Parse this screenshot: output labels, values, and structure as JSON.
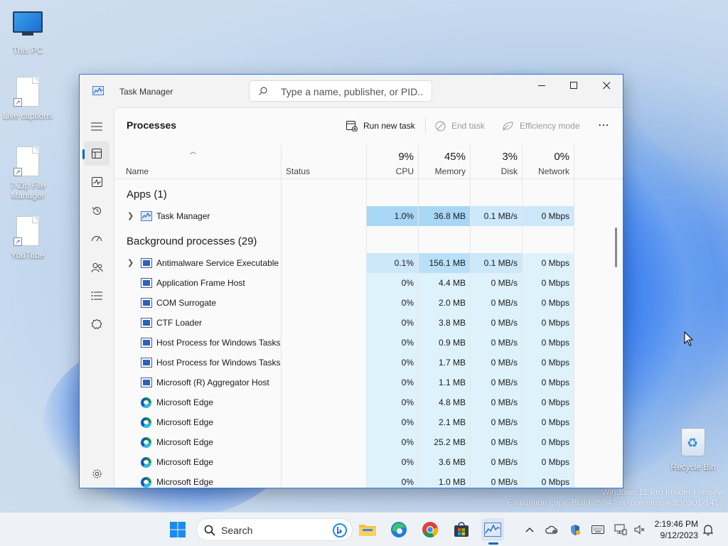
{
  "desktop": {
    "icons": [
      "This PC",
      "Live captions",
      "7-Zip File Manager",
      "YouTube",
      "Recycle Bin"
    ],
    "watermark_line1": "Windows 11 Pro Insider Preview",
    "watermark_line2": "Evaluation copy. Build 25947.rs_prerelease.230901-1416"
  },
  "window": {
    "title": "Task Manager",
    "search_placeholder": "Type a name, publisher, or PID...",
    "controls": [
      "minimize-icon",
      "maximize-icon",
      "close-icon"
    ]
  },
  "nav": {
    "items": [
      "hamburger-icon",
      "processes-icon",
      "performance-icon",
      "app-history-icon",
      "startup-apps-icon",
      "users-icon",
      "details-icon",
      "services-icon",
      "settings-icon"
    ],
    "active": "processes"
  },
  "page": {
    "title": "Processes",
    "run_new_task": "Run new task",
    "end_task": "End task",
    "efficiency_mode": "Efficiency mode",
    "more": "⋯"
  },
  "columns": {
    "name": "Name",
    "status": "Status",
    "cpu_pct": "9%",
    "cpu": "CPU",
    "memory_pct": "45%",
    "memory": "Memory",
    "disk_pct": "3%",
    "disk": "Disk",
    "network_pct": "0%",
    "network": "Network"
  },
  "groups": {
    "apps": "Apps (1)",
    "background": "Background processes (29)"
  },
  "apps": [
    {
      "name": "Task Manager",
      "cpu": "1.0%",
      "memory": "36.8 MB",
      "disk": "0.1 MB/s",
      "network": "0 Mbps"
    }
  ],
  "background": [
    {
      "name": "Antimalware Service Executable",
      "cpu": "0.1%",
      "memory": "156.1 MB",
      "disk": "0.1 MB/s",
      "network": "0 Mbps"
    },
    {
      "name": "Application Frame Host",
      "cpu": "0%",
      "memory": "4.4 MB",
      "disk": "0 MB/s",
      "network": "0 Mbps"
    },
    {
      "name": "COM Surrogate",
      "cpu": "0%",
      "memory": "2.0 MB",
      "disk": "0 MB/s",
      "network": "0 Mbps"
    },
    {
      "name": "CTF Loader",
      "cpu": "0%",
      "memory": "3.8 MB",
      "disk": "0 MB/s",
      "network": "0 Mbps"
    },
    {
      "name": "Host Process for Windows Tasks",
      "cpu": "0%",
      "memory": "0.9 MB",
      "disk": "0 MB/s",
      "network": "0 Mbps"
    },
    {
      "name": "Host Process for Windows Tasks",
      "cpu": "0%",
      "memory": "1.7 MB",
      "disk": "0 MB/s",
      "network": "0 Mbps"
    },
    {
      "name": "Microsoft (R) Aggregator Host",
      "cpu": "0%",
      "memory": "1.1 MB",
      "disk": "0 MB/s",
      "network": "0 Mbps"
    },
    {
      "name": "Microsoft Edge",
      "cpu": "0%",
      "memory": "4.8 MB",
      "disk": "0 MB/s",
      "network": "0 Mbps"
    },
    {
      "name": "Microsoft Edge",
      "cpu": "0%",
      "memory": "2.1 MB",
      "disk": "0 MB/s",
      "network": "0 Mbps"
    },
    {
      "name": "Microsoft Edge",
      "cpu": "0%",
      "memory": "25.2 MB",
      "disk": "0 MB/s",
      "network": "0 Mbps"
    },
    {
      "name": "Microsoft Edge",
      "cpu": "0%",
      "memory": "3.6 MB",
      "disk": "0 MB/s",
      "network": "0 Mbps"
    },
    {
      "name": "Microsoft Edge",
      "cpu": "0%",
      "memory": "1.0 MB",
      "disk": "0 MB/s",
      "network": "0 Mbps"
    }
  ],
  "taskbar": {
    "search_label": "Search",
    "time": "2:19:46 PM",
    "date": "9/12/2023"
  },
  "colors": {
    "accent": "#0067c0",
    "heat_light": "#def2fc",
    "heat_mid": "#cce8fa",
    "heat_high": "#a8d7f5"
  }
}
